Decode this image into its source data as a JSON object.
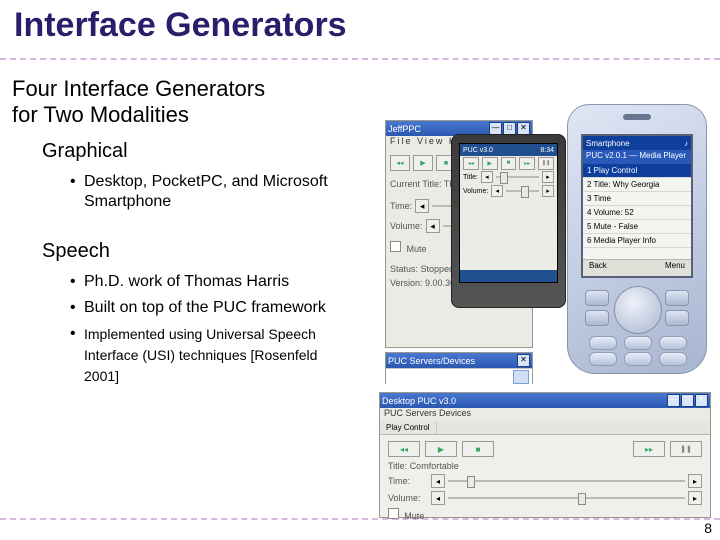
{
  "title": "Interface Generators",
  "subtitle_line1": "Four Interface Generators",
  "subtitle_line2": "for Two Modalities",
  "sections": {
    "graphical": {
      "heading": "Graphical",
      "items": [
        "Desktop, PocketPC, and Microsoft Smartphone"
      ]
    },
    "speech": {
      "heading": "Speech",
      "items": [
        "Ph.D. work of Thomas Harris",
        "Built on top of the PUC framework",
        "Implemented using Universal Speech Interface (USI) techniques [Rosenfeld 2001]"
      ]
    }
  },
  "page_number": "8",
  "desktop_window": {
    "title": "JeffPPC",
    "menu": "File View Help",
    "title_label": "Current Title:",
    "title_value": "The One And Only",
    "time_label": "Time:",
    "volume_label": "Volume:",
    "mute_label": "Mute",
    "status_label": "Status:",
    "status_value": "Stopped",
    "version_label": "Version:",
    "version_value": "9.00.3005"
  },
  "puc_servers_window": {
    "title": "PUC Servers/Devices"
  },
  "desktop_puc_window": {
    "title": "Desktop PUC v3.0",
    "menu": "PUC  Servers  Devices",
    "play_label": "Play Control",
    "title_label": "Title:",
    "title_value": "Comfortable",
    "time_label": "Time:",
    "volume_label": "Volume:",
    "mute_label": "Mute"
  },
  "pocketpc": {
    "topbar_left": "PUC v3.0",
    "topbar_right": "8:34",
    "title_label": "Title:",
    "volume_label": "Volume:"
  },
  "smartphone": {
    "hdr_left": "Smartphone",
    "hdr_right": "♪",
    "hdr2": "PUC v2.0.1 — Media Player",
    "menu_items": [
      "1  Play Control",
      "2  Title: Why Georgia",
      "3  Time",
      "4  Volume: 52",
      "5  Mute - False",
      "6  Media Player Info"
    ],
    "soft_left": "Back",
    "soft_right": "Menu"
  },
  "icons": {
    "prev": "◂◂",
    "play": "▶",
    "stop": "■",
    "next": "▸▸",
    "pause": "❚❚",
    "close": "✕",
    "min": "—",
    "max": "□"
  }
}
